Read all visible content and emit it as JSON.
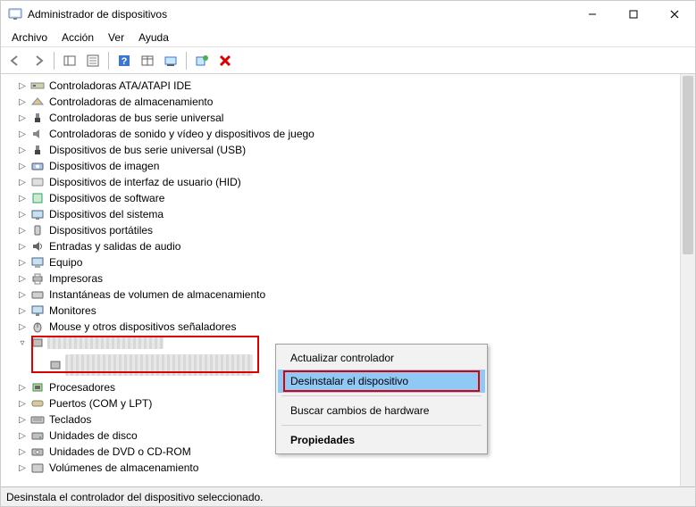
{
  "title": "Administrador de dispositivos",
  "menu": {
    "archivo": "Archivo",
    "accion": "Acción",
    "ver": "Ver",
    "ayuda": "Ayuda"
  },
  "status": "Desinstala el controlador del dispositivo seleccionado.",
  "tree": {
    "n0": "Controladoras ATA/ATAPI IDE",
    "n1": "Controladoras de almacenamiento",
    "n2": "Controladoras de bus serie universal",
    "n3": "Controladoras de sonido y vídeo y dispositivos de juego",
    "n4": "Dispositivos de bus serie universal (USB)",
    "n5": "Dispositivos de imagen",
    "n6": "Dispositivos de interfaz de usuario (HID)",
    "n7": "Dispositivos de software",
    "n8": "Dispositivos del sistema",
    "n9": "Dispositivos portátiles",
    "n10": "Entradas y salidas de audio",
    "n11": "Equipo",
    "n12": "Impresoras",
    "n13": "Instantáneas de volumen de almacenamiento",
    "n14": "Monitores",
    "n15": "Mouse y otros dispositivos señaladores",
    "n17": "Procesadores",
    "n18": "Puertos (COM y LPT)",
    "n19": "Teclados",
    "n20": "Unidades de disco",
    "n21": "Unidades de DVD o CD-ROM",
    "n22": "Volúmenes de almacenamiento"
  },
  "ctx": {
    "update": "Actualizar controlador",
    "uninstall": "Desinstalar el dispositivo",
    "scan": "Buscar cambios de hardware",
    "props": "Propiedades"
  }
}
